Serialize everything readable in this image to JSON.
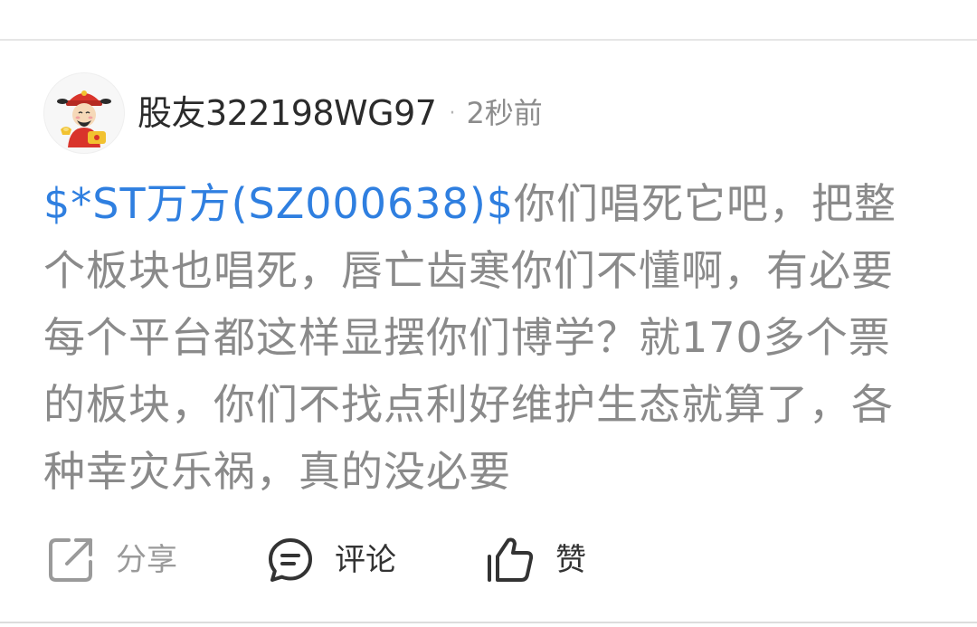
{
  "post": {
    "author": "股友322198WG97",
    "separator": "·",
    "time": "2秒前",
    "stock_tag": "$*ST万方(SZ000638)$",
    "content": "你们唱死它吧，把整个板块也唱死，唇亡齿寒你们不懂啊，有必要每个平台都这样显摆你们博学？就170多个票的板块，你们不找点利好维护生态就算了，各种幸灾乐祸，真的没必要"
  },
  "actions": {
    "share_label": "分享",
    "comment_label": "评论",
    "like_label": "赞"
  },
  "colors": {
    "stock_link": "#2f7fe0",
    "body_text": "#8a8a8a",
    "author_text": "#2b2b2b",
    "time_text": "#8c8c8c",
    "icon_dark": "#333333",
    "icon_muted": "#9a9a9a"
  },
  "icons": {
    "avatar": "caishen-avatar-icon",
    "share": "share-icon",
    "comment": "comment-icon",
    "like": "thumbs-up-icon"
  }
}
